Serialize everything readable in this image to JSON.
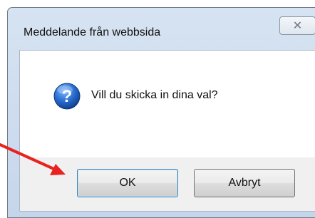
{
  "dialog": {
    "title": "Meddelande från webbsida",
    "close_icon": "close-icon",
    "message": "Vill du skicka in dina val?",
    "message_icon": "question-icon",
    "buttons": {
      "ok_label": "OK",
      "cancel_label": "Avbryt"
    }
  },
  "annotation": {
    "arrow_color": "#e8231f",
    "arrow_target": "ok-button"
  },
  "colors": {
    "icon_blue": "#1d63c7",
    "default_button_border": "#3c7fb1"
  }
}
